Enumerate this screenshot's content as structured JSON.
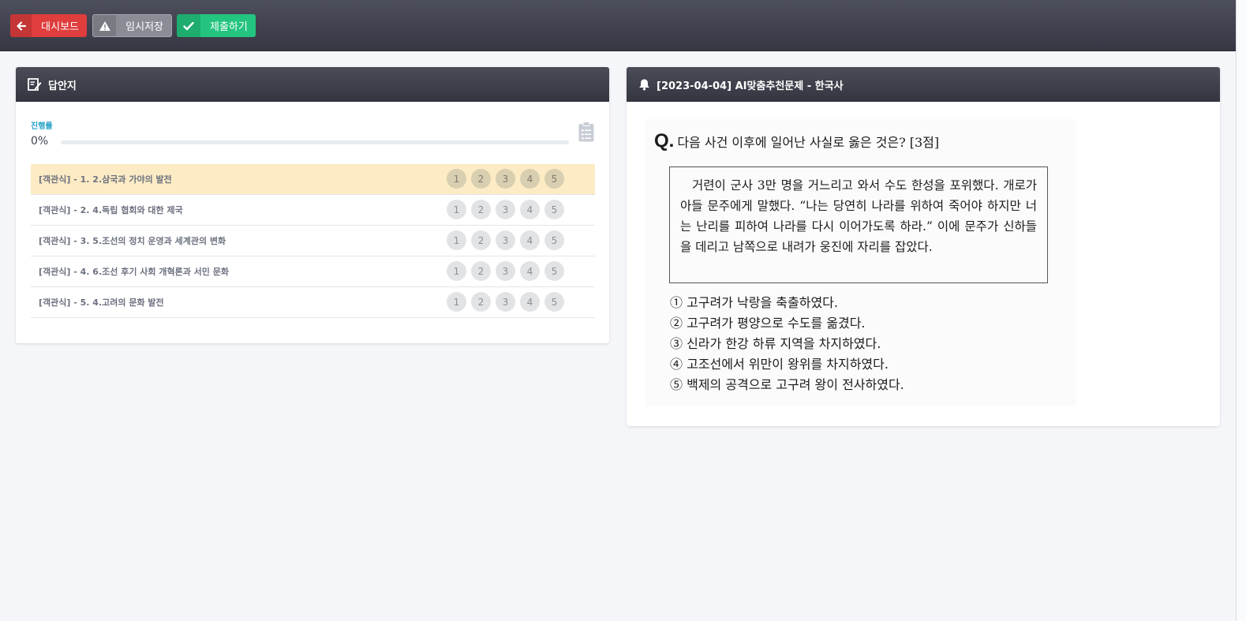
{
  "toolbar": {
    "dashboard_label": "대시보드",
    "save_label": "임시저장",
    "submit_label": "제출하기"
  },
  "answer_sheet": {
    "title": "답안지",
    "progress_label": "진행률",
    "progress_value": "0%",
    "progress_fraction": 0,
    "questions": [
      {
        "label": "[객관식] - 1. 2.삼국과 가야의 발전",
        "options": [
          "1",
          "2",
          "3",
          "4",
          "5"
        ]
      },
      {
        "label": "[객관식] - 2. 4.독립 협회와 대한 제국",
        "options": [
          "1",
          "2",
          "3",
          "4",
          "5"
        ]
      },
      {
        "label": "[객관식] - 3. 5.조선의 정치 운영과 세계관의 변화",
        "options": [
          "1",
          "2",
          "3",
          "4",
          "5"
        ]
      },
      {
        "label": "[객관식] - 4. 6.조선 후기 사회 개혁론과 서민 문화",
        "options": [
          "1",
          "2",
          "3",
          "4",
          "5"
        ]
      },
      {
        "label": "[객관식] - 5. 4.고려의 문화 발전",
        "options": [
          "1",
          "2",
          "3",
          "4",
          "5"
        ]
      }
    ]
  },
  "problem": {
    "title": "[2023-04-04] AI맞춤추천문제 - 한국사",
    "q_mark": "Q.",
    "question": "다음 사건 이후에 일어난 사실로 옳은 것은? [3점]",
    "passage": "거련이 군사 3만 명을 거느리고 와서 수도 한성을 포위했다. 개로가 아들 문주에게 말했다. “나는 당연히 나라를 위하여 죽어야 하지만 너는 난리를 피하여 나라를 다시 이어가도록 하라.” 이에 문주가 신하들을 데리고 남쪽으로 내려가 웅진에 자리를 잡았다.",
    "choices": [
      "① 고구려가 낙랑을 축출하였다.",
      "② 고구려가 평양으로 수도를 옮겼다.",
      "③ 신라가 한강 하류 지역을 차지하였다.",
      "④ 고조선에서 위만이 왕위를 차지하였다.",
      "⑤ 백제의 공격으로 고구려 왕이 전사하였다."
    ]
  },
  "colors": {
    "accent": "#22a0c8",
    "danger": "#e03d3d",
    "success": "#23c47f",
    "active_row": "#fcebc4"
  },
  "icons": {
    "dashboard": "arrow-left-icon",
    "save": "warning-icon",
    "submit": "check-icon",
    "answer_sheet": "edit-note-icon",
    "problem": "bell-icon",
    "progress": "clipboard-icon"
  }
}
